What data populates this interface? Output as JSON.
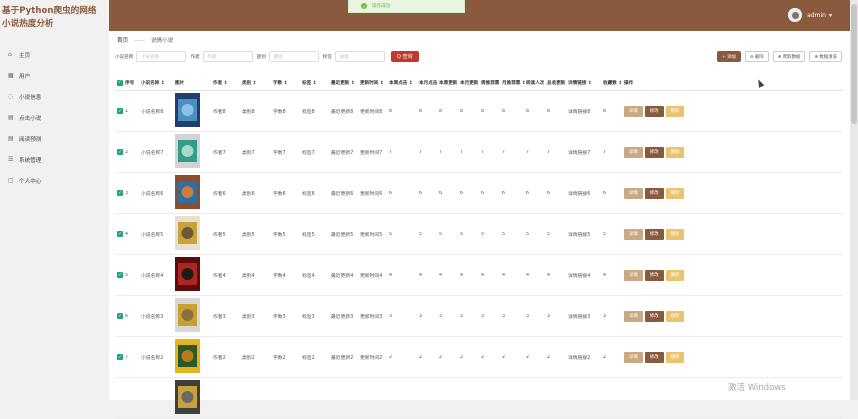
{
  "brand": {
    "title": "基于Python爬虫的网络小说热度分析"
  },
  "sidebar": {
    "items": [
      {
        "icon": "⌂",
        "icon_name": "home-icon",
        "label": "主页"
      },
      {
        "icon": "▦",
        "icon_name": "user-icon",
        "label": "用户"
      },
      {
        "icon": "◌",
        "icon_name": "info-icon",
        "label": "小说信息"
      },
      {
        "icon": "▤",
        "icon_name": "ranking-icon",
        "label": "点击小说"
      },
      {
        "icon": "▤",
        "icon_name": "grid-icon",
        "label": "阅读预测"
      },
      {
        "icon": "☰",
        "icon_name": "system-icon",
        "label": "系统管理"
      },
      {
        "icon": "▢",
        "icon_name": "profile-icon",
        "label": "个人中心"
      }
    ]
  },
  "toast": {
    "text": "操作成功"
  },
  "user": {
    "name": "admin",
    "caret": "▾"
  },
  "breadcrumb": {
    "home": "首页",
    "sep": "——",
    "current": "说情小说"
  },
  "filters": {
    "fields": [
      {
        "label": "小说名称",
        "placeholder": "小说名称"
      },
      {
        "label": "作者",
        "placeholder": "作者"
      },
      {
        "label": "题别",
        "placeholder": "题别"
      },
      {
        "label": "标签",
        "placeholder": "标签"
      }
    ],
    "query_label": "Q 查询"
  },
  "actions": {
    "add": "+ 添加",
    "delete": "⊖ 删除",
    "crawl": "⊕ 爬取数据",
    "clean": "⊕ 数据清洗"
  },
  "table": {
    "headers": [
      "序号",
      "小说名称 ↕",
      "图片",
      "作者 ↕",
      "类别 ↕",
      "字数 ↕",
      "标签 ↕",
      "最近更新 ↕",
      "更新时间 ↕",
      "本周点击 ↕",
      "本月点击 ↕",
      "本周更新 ↕",
      "本月更新 ↕",
      "周推荐票 ↕",
      "月推荐票 ↕",
      "阅读人次 ↕",
      "总收更新 ↕",
      "详情链接 ↕",
      "收藏数 ↕",
      "操作"
    ],
    "buttons": {
      "detail": "详情",
      "edit": "修改",
      "delete": "删除"
    },
    "rows": [
      {
        "index": "1",
        "name": "小说名称8",
        "cells": [
          "作者8",
          "类别8",
          "字数8",
          "标签8",
          "最近更新8",
          "更新时间8",
          "8",
          "8",
          "8",
          "8",
          "8",
          "8",
          "8",
          "8",
          "详情链接8",
          "8"
        ],
        "cover_colors": [
          "#1f3f6e",
          "#4f8fc0",
          "#89c2e8"
        ]
      },
      {
        "index": "2",
        "name": "小说名称7",
        "cells": [
          "作者7",
          "类别7",
          "字数7",
          "标签7",
          "最近更新7",
          "更新时间7",
          "7",
          "7",
          "7",
          "7",
          "7",
          "7",
          "7",
          "7",
          "详情链接7",
          "7"
        ],
        "cover_colors": [
          "#d3d3d3",
          "#2f9c8c",
          "#a8d8c8"
        ]
      },
      {
        "index": "3",
        "name": "小说名称6",
        "cells": [
          "作者6",
          "类别6",
          "字数6",
          "标签6",
          "最近更新6",
          "更新时间6",
          "6",
          "6",
          "6",
          "6",
          "6",
          "6",
          "6",
          "6",
          "详情链接6",
          "6"
        ],
        "cover_colors": [
          "#8c4f2d",
          "#2c6fa0",
          "#d07a3e"
        ]
      },
      {
        "index": "4",
        "name": "小说名称5",
        "cells": [
          "作者5",
          "类别5",
          "字数5",
          "标签5",
          "最近更新5",
          "更新时间5",
          "5",
          "5",
          "5",
          "5",
          "5",
          "5",
          "5",
          "5",
          "详情链接5",
          "5"
        ],
        "cover_colors": [
          "#e6e0cf",
          "#c9a23a",
          "#6b5a3b"
        ]
      },
      {
        "index": "5",
        "name": "小说名称4",
        "cells": [
          "作者4",
          "类别4",
          "字数4",
          "标签4",
          "最近更新4",
          "更新时间4",
          "4",
          "4",
          "4",
          "4",
          "4",
          "4",
          "4",
          "4",
          "详情链接4",
          "4"
        ],
        "cover_colors": [
          "#5b0d0d",
          "#b3231f",
          "#1b1b1b"
        ]
      },
      {
        "index": "6",
        "name": "小说名称3",
        "cells": [
          "作者3",
          "类别3",
          "字数3",
          "标签3",
          "最近更新3",
          "更新时间3",
          "3",
          "3",
          "3",
          "3",
          "3",
          "3",
          "3",
          "3",
          "详情链接3",
          "3"
        ],
        "cover_colors": [
          "#d7d7d7",
          "#c8a12f",
          "#8a7040"
        ]
      },
      {
        "index": "7",
        "name": "小说名称2",
        "cells": [
          "作者2",
          "类别2",
          "字数2",
          "标签2",
          "最近更新2",
          "更新时间2",
          "2",
          "2",
          "2",
          "2",
          "2",
          "2",
          "2",
          "2",
          "详情链接2",
          "2"
        ],
        "cover_colors": [
          "#e3b41e",
          "#2a5a2a",
          "#b57a1a"
        ]
      },
      {
        "index": "",
        "name": "",
        "cells": [],
        "cover_colors": [
          "#3e3e3e",
          "#c9a13a",
          "#6a6a6a"
        ]
      }
    ]
  },
  "watermark": {
    "text": "激活 Windows"
  },
  "colors": {
    "topbar": "#8a5a3c",
    "accent_red": "#c0392b",
    "checkbox": "#1fa67a"
  }
}
